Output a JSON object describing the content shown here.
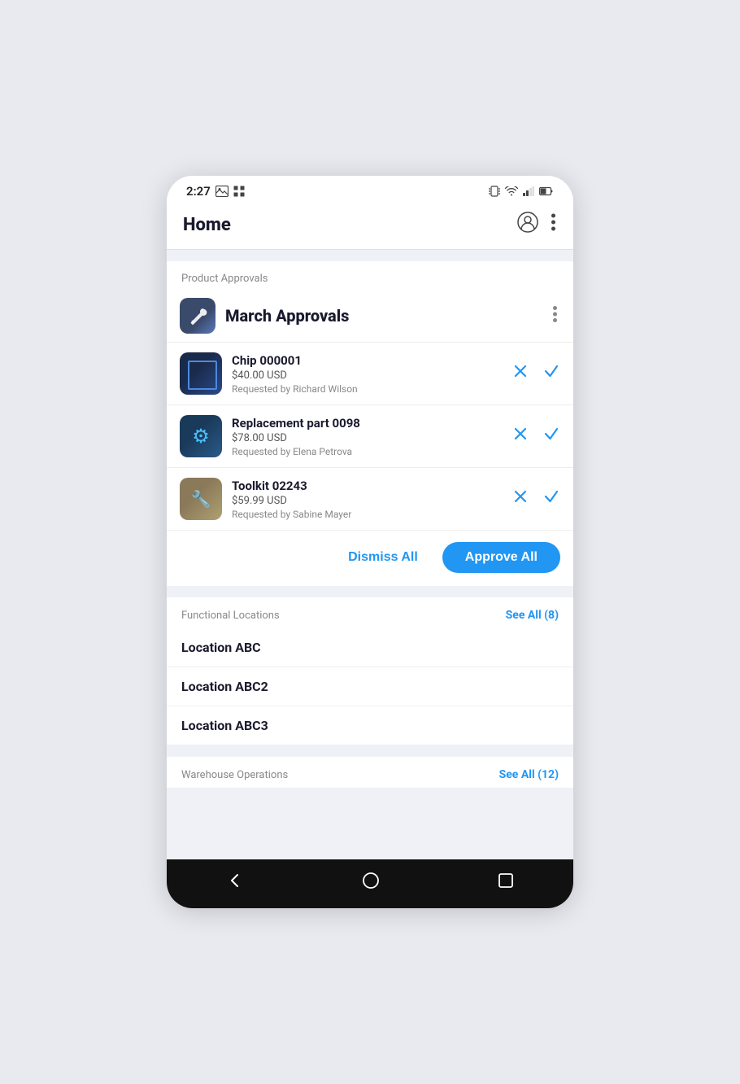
{
  "statusBar": {
    "time": "2:27",
    "icons": [
      "image-icon",
      "grid-icon",
      "vibrate-icon",
      "wifi-icon",
      "signal-icon",
      "battery-icon"
    ]
  },
  "topBar": {
    "title": "Home",
    "profileIcon": "profile-icon",
    "moreIcon": "more-icon"
  },
  "productApprovals": {
    "sectionLabel": "Product Approvals",
    "title": "March Approvals",
    "moreIcon": "more-dots-icon",
    "items": [
      {
        "name": "Chip 000001",
        "price": "$40.00 USD",
        "requester": "Requested by Richard Wilson",
        "imageType": "chip"
      },
      {
        "name": "Replacement part 0098",
        "price": "$78.00 USD",
        "requester": "Requested by Elena Petrova",
        "imageType": "part"
      },
      {
        "name": "Toolkit 02243",
        "price": "$59.99 USD",
        "requester": "Requested by Sabine Mayer",
        "imageType": "toolkit"
      }
    ],
    "dismissLabel": "Dismiss All",
    "approveAllLabel": "Approve All"
  },
  "functionalLocations": {
    "sectionLabel": "Functional Locations",
    "seeAllLabel": "See All (8)",
    "locations": [
      {
        "name": "Location ABC"
      },
      {
        "name": "Location ABC2"
      },
      {
        "name": "Location ABC3"
      }
    ]
  },
  "warehouseOperations": {
    "sectionLabel": "Warehouse Operations",
    "seeAllLabel": "See All (12)"
  }
}
